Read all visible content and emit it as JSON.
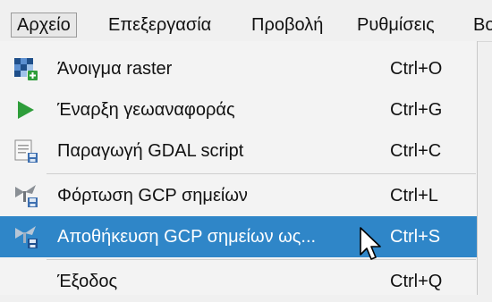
{
  "menubar": {
    "items": [
      {
        "label": "Αρχείο",
        "active": true
      },
      {
        "label": "Επεξεργασία",
        "active": false
      },
      {
        "label": "Προβολή",
        "active": false
      },
      {
        "label": "Ρυθμίσεις",
        "active": false
      },
      {
        "label": "Βο",
        "active": false
      }
    ]
  },
  "file_menu": {
    "items": [
      {
        "label": "Άνοιγμα raster",
        "shortcut": "Ctrl+O",
        "icon": "open-raster-icon"
      },
      {
        "label": "Έναρξη γεωαναφοράς",
        "shortcut": "Ctrl+G",
        "icon": "play-icon"
      },
      {
        "label": "Παραγωγή GDAL script",
        "shortcut": "Ctrl+C",
        "icon": "script-icon"
      },
      {
        "label": "Φόρτωση GCP σημείων",
        "shortcut": "Ctrl+L",
        "icon": "load-gcp-icon"
      },
      {
        "label": "Αποθήκευση GCP σημείων ως...",
        "shortcut": "Ctrl+S",
        "icon": "save-gcp-icon",
        "highlighted": true
      },
      {
        "label": "Έξοδος",
        "shortcut": "Ctrl+Q",
        "icon": null
      }
    ]
  },
  "colors": {
    "highlight": "#2f86c8",
    "menu_background": "#f3f3f3",
    "play_green": "#2e9d3a"
  }
}
